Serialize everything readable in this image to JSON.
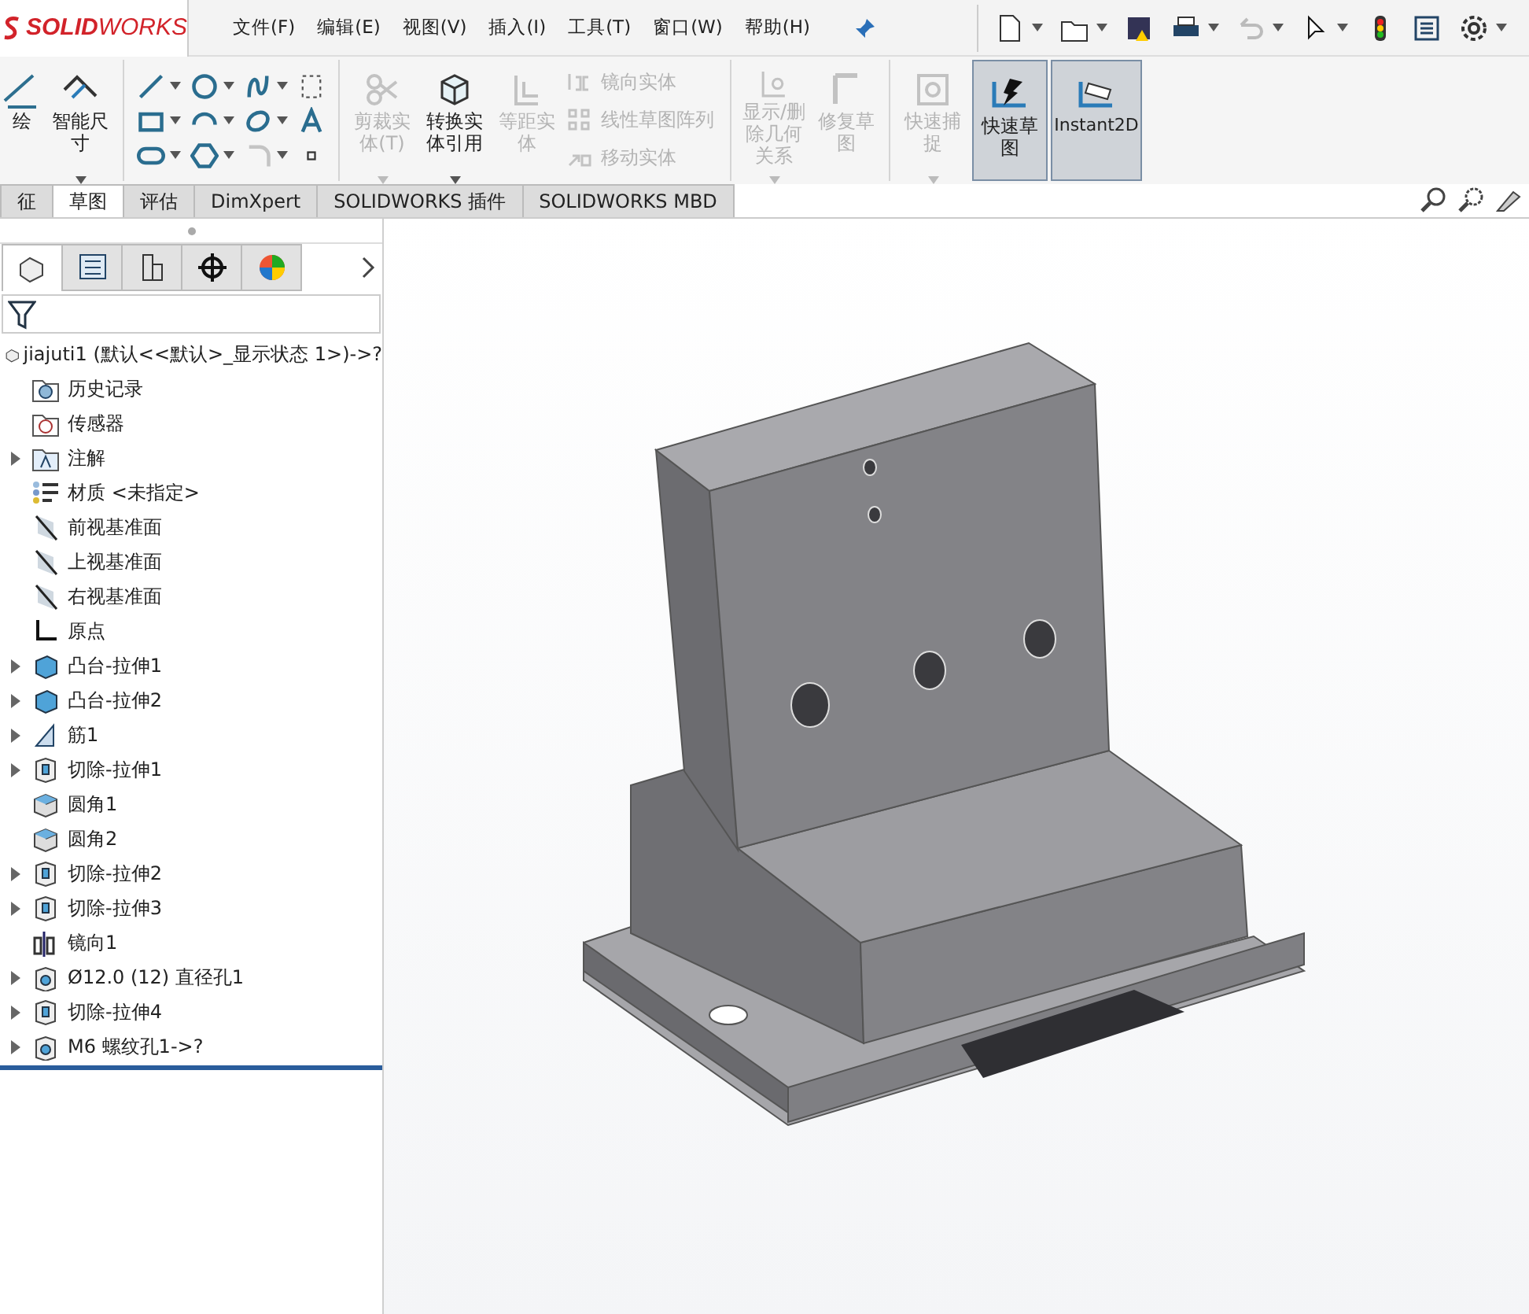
{
  "logo": "**SOLID**WORKS",
  "menu": [
    "文件(F)",
    "编辑(E)",
    "视图(V)",
    "插入(I)",
    "工具(T)",
    "窗口(W)",
    "帮助(H)"
  ],
  "ribbon": [
    {
      "kind": "large",
      "label": "绘",
      "disabled": false,
      "dropdown": false
    },
    {
      "kind": "large",
      "label": "智能尺寸",
      "disabled": false,
      "dropdown": true
    },
    {
      "kind": "separator"
    },
    {
      "kind": "tools"
    },
    {
      "kind": "separator"
    },
    {
      "kind": "large",
      "label": "剪裁实体(T)",
      "disabled": true,
      "dropdown": true
    },
    {
      "kind": "large",
      "label": "转换实体引用",
      "disabled": false,
      "dropdown": true
    },
    {
      "kind": "large",
      "label": "等距实体",
      "disabled": true,
      "dropdown": false
    },
    {
      "kind": "list",
      "items": [
        {
          "label": "镜向实体",
          "disabled": true
        },
        {
          "label": "线性草图阵列",
          "disabled": true
        },
        {
          "label": "移动实体",
          "disabled": true
        }
      ]
    },
    {
      "kind": "separator"
    },
    {
      "kind": "large",
      "label": "显示/删除几何关系",
      "disabled": true,
      "dropdown": true
    },
    {
      "kind": "large",
      "label": "修复草图",
      "disabled": true,
      "dropdown": false
    },
    {
      "kind": "separator"
    },
    {
      "kind": "large",
      "label": "快速捕捉",
      "disabled": true,
      "dropdown": true
    },
    {
      "kind": "toggle",
      "label": "快速草图",
      "selected": true
    },
    {
      "kind": "toggle",
      "label": "Instant2D",
      "selected": true
    }
  ],
  "tabs": [
    {
      "label": "征",
      "selected": false
    },
    {
      "label": "草图",
      "selected": true
    },
    {
      "label": "评估",
      "selected": false
    },
    {
      "label": "DimXpert",
      "selected": false
    },
    {
      "label": "SOLIDWORKS 插件",
      "selected": false
    },
    {
      "label": "SOLIDWORKS MBD",
      "selected": false
    }
  ],
  "panel_tabs": [
    {
      "kind": "tree",
      "selected": true
    },
    {
      "kind": "property",
      "selected": false
    },
    {
      "kind": "config",
      "selected": false
    },
    {
      "kind": "dim",
      "selected": false
    },
    {
      "kind": "display",
      "selected": false
    }
  ],
  "tree": {
    "label": "jiajuti1  (默认<<默认>_显示状态 1>)->?",
    "kind": "part",
    "children": [
      {
        "label": "历史记录",
        "kind": "history",
        "expandable": false
      },
      {
        "label": "传感器",
        "kind": "sensor",
        "expandable": false
      },
      {
        "label": "注解",
        "kind": "annotation",
        "expandable": true
      },
      {
        "label": "材质 <未指定>",
        "kind": "material",
        "expandable": false
      },
      {
        "label": "前视基准面",
        "kind": "plane",
        "expandable": false
      },
      {
        "label": "上视基准面",
        "kind": "plane",
        "expandable": false
      },
      {
        "label": "右视基准面",
        "kind": "plane",
        "expandable": false
      },
      {
        "label": "原点",
        "kind": "origin",
        "expandable": false
      },
      {
        "label": "凸台-拉伸1",
        "kind": "boss",
        "expandable": true
      },
      {
        "label": "凸台-拉伸2",
        "kind": "boss",
        "expandable": true
      },
      {
        "label": "筋1",
        "kind": "rib",
        "expandable": true
      },
      {
        "label": "切除-拉伸1",
        "kind": "cut",
        "expandable": true
      },
      {
        "label": "圆角1",
        "kind": "fillet",
        "expandable": false
      },
      {
        "label": "圆角2",
        "kind": "fillet",
        "expandable": false
      },
      {
        "label": "切除-拉伸2",
        "kind": "cut",
        "expandable": true
      },
      {
        "label": "切除-拉伸3",
        "kind": "cut",
        "expandable": true
      },
      {
        "label": "镜向1",
        "kind": "mirror",
        "expandable": false
      },
      {
        "label": "Ø12.0 (12) 直径孔1",
        "kind": "hole",
        "expandable": true
      },
      {
        "label": "切除-拉伸4",
        "kind": "cut",
        "expandable": true
      },
      {
        "label": "M6 螺纹孔1->?",
        "kind": "hole",
        "expandable": true
      }
    ]
  }
}
